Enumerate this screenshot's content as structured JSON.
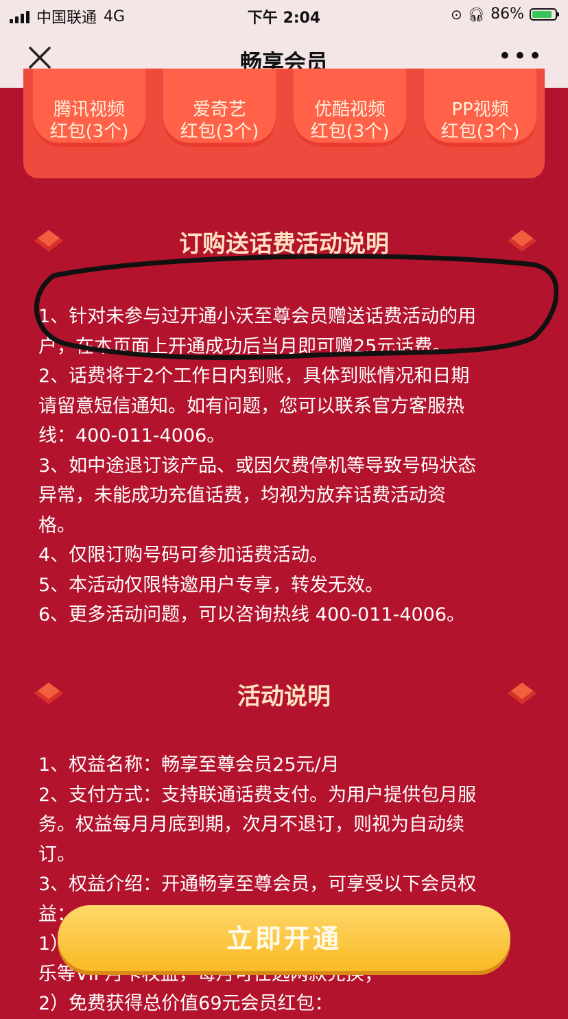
{
  "status_bar": {
    "carrier": "中国联通",
    "network": "4G",
    "time": "下午 2:04",
    "battery_percent": "86%",
    "battery_level": 0.86
  },
  "nav": {
    "title": "畅享会员",
    "more": "•••"
  },
  "coupons": [
    {
      "name": "腾讯视频",
      "desc": "红包(3个)"
    },
    {
      "name": "爱奇艺",
      "desc": "红包(3个)"
    },
    {
      "name": "优酷视频",
      "desc": "红包(3个)"
    },
    {
      "name": "PP视频",
      "desc": "红包(3个)"
    }
  ],
  "section1": {
    "title": "订购送话费活动说明",
    "lines": [
      "1、针对未参与过开通小沃至尊会员赠送话费活动的用",
      "户，在本页面上开通成功后当月即可赠25元话费。",
      "2、话费将于2个工作日内到账，具体到账情况和日期",
      "请留意短信通知。如有问题，您可以联系官方客服热",
      "线：400-011-4006。",
      "3、如中途退订该产品、或因欠费停机等导致号码状态",
      "异常，未能成功充值话费，均视为放弃话费活动资",
      "格。",
      "4、仅限订购号码可参加话费活动。",
      "5、本活动仅限特邀用户专享，转发无效。",
      "6、更多活动问题，可以咨询热线 400-011-4006。"
    ]
  },
  "section2": {
    "title": "活动说明",
    "lines": [
      "1、权益名称：畅享至尊会员25元/月",
      "2、支付方式：支持联通话费支付。为用户提供包月服",
      "务。权益每月月底到期，次月不退订，则视为自动续",
      "订。",
      "3、权益介绍：开通畅享至尊会员，可享受以下会员权",
      "益：",
      "1）",
      "乐等VIP月卡权益，每月可任选两款兑换；",
      "2）免费获得总价值69元会员红包："
    ]
  },
  "cta": {
    "label": "立即开通"
  },
  "colors": {
    "page_bg": "#b3132c",
    "coupon_panel": "#ef4a3e",
    "cta": "#f9ba25"
  }
}
